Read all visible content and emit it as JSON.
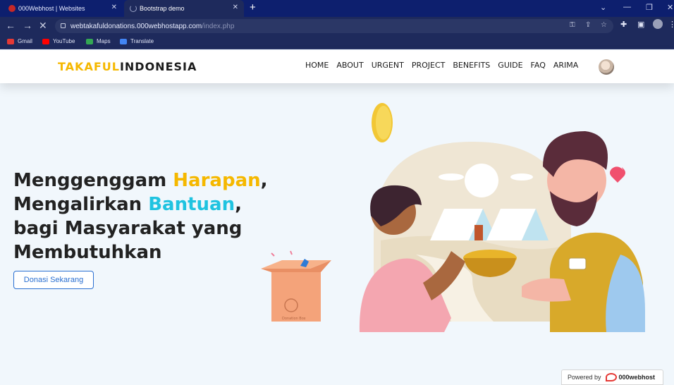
{
  "browser": {
    "tabs": [
      {
        "title": "000Webhost | Websites",
        "active": false
      },
      {
        "title": "Bootstrap demo",
        "active": true
      }
    ],
    "url_host": "webtakafuldonations.000webhostapp.com",
    "url_path": "/index.php",
    "bookmarks": [
      "Gmail",
      "YouTube",
      "Maps",
      "Translate"
    ]
  },
  "site": {
    "brand_part1": "TAKAFUL",
    "brand_part2": "INDONESIA",
    "menu": [
      "HOME",
      "ABOUT",
      "URGENT",
      "PROJECT",
      "BENEFITS",
      "GUIDE",
      "FAQ",
      "ARIMA"
    ],
    "headline": {
      "l1a": "Menggenggam ",
      "l1b": "Harapan",
      "l1c": ",",
      "l2a": "Mengalirkan ",
      "l2b": "Bantuan",
      "l2c": ",",
      "l3": "bagi Masyarakat yang",
      "l4": "Membutuhkan"
    },
    "cta_label": "Donasi Sekarang",
    "box_label": "Donation Box",
    "powered_by": "Powered by",
    "powered_brand": "000webhost"
  },
  "colors": {
    "accent_yellow": "#f5b800",
    "accent_cyan": "#1fc3e0",
    "button_blue": "#2a6fd1",
    "chrome_bg": "#0d1f6e"
  }
}
